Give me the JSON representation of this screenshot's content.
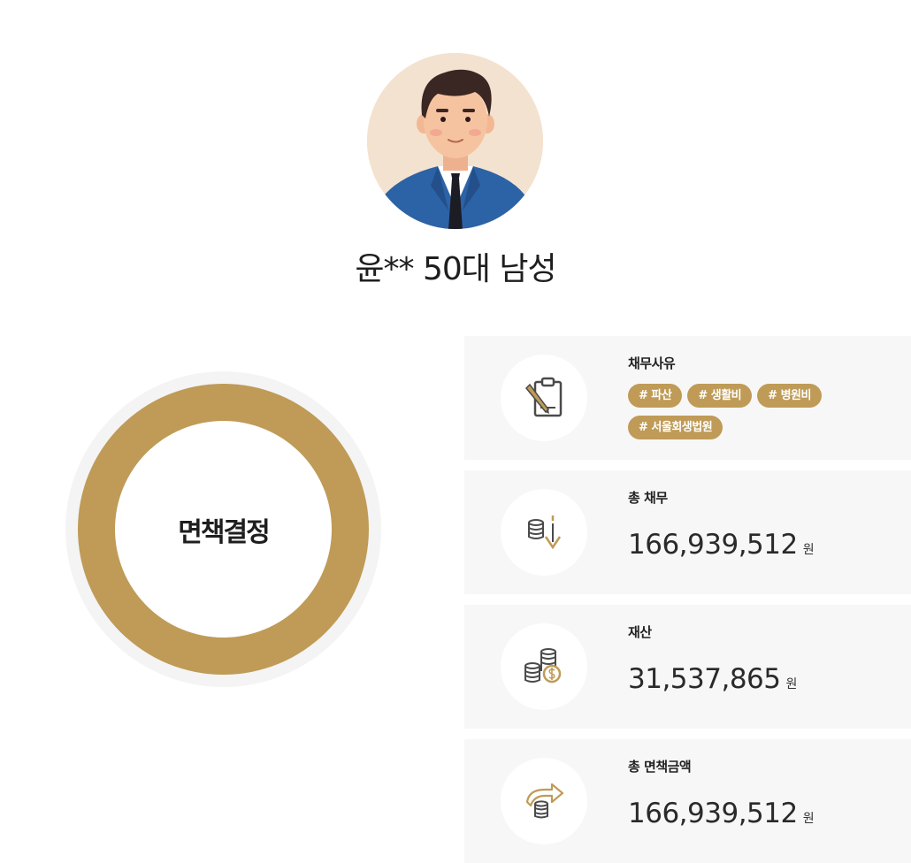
{
  "profile": {
    "avatar_icon": "man-in-suit-avatar",
    "title": "윤** 50대 남성"
  },
  "result": {
    "label": "면책결정",
    "accent_color": "#bf9b57"
  },
  "cards": {
    "reason": {
      "label": "채무사유",
      "icon": "clipboard-pencil-icon",
      "tags": [
        "# 파산",
        "# 생활비",
        "# 병원비",
        "# 서울회생법원"
      ]
    },
    "total_debt": {
      "label": "총 채무",
      "icon": "coins-down-arrow-icon",
      "value": "166,939,512",
      "unit": "원"
    },
    "assets": {
      "label": "재산",
      "icon": "coins-stack-icon",
      "value": "31,537,865",
      "unit": "원"
    },
    "total_exemption": {
      "label": "총 면책금액",
      "icon": "coins-curved-arrow-icon",
      "value": "166,939,512",
      "unit": "원"
    }
  }
}
